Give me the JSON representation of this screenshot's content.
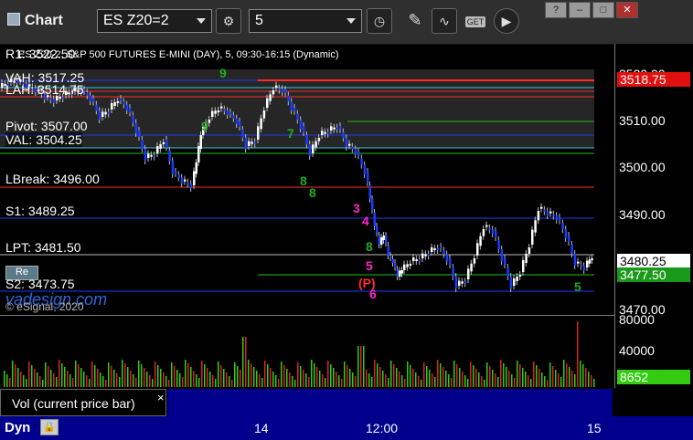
{
  "window": {
    "title": "Chart",
    "controls": [
      "?",
      "–",
      "□",
      "✕"
    ]
  },
  "toolbar": {
    "symbol": "ES Z20=2",
    "interval": "5",
    "icons": [
      "gear-icon",
      "clock-icon",
      "pencil-icon",
      "indicator-icon",
      "get-data-icon",
      "play-icon"
    ],
    "get_label": "GET"
  },
  "chart": {
    "header": "ES Z20-2, S&P 500 FUTURES E-MINI (DAY), 5, 09:30-16:15 (Dynamic)",
    "levels": {
      "r1": "R1: 3522.50",
      "vah": "VAH: 3517.25",
      "lah": "LAH: 3514.75",
      "pivot": "Pivot: 3507.00",
      "val": "VAL: 3504.25",
      "lbreak": "LBreak: 3496.00",
      "s1": "S1: 3489.25",
      "lpt": "LPT: 3481.50",
      "s2": "S2: 3473.75"
    },
    "price_ticks": [
      "3520.00",
      "3510.00",
      "3500.00",
      "3490.00",
      "3480.25",
      "3477.50",
      "3470.00"
    ],
    "last_price": "3518.75",
    "current_price": "3480.25",
    "other_price": "3477.50",
    "markers": [
      "9",
      "8",
      "3",
      "4",
      "5",
      "(P)",
      "6",
      "5",
      "8",
      "8",
      "7",
      "9"
    ],
    "watermark": "vadesign.com",
    "copyright": "© eSignal, 2020",
    "badge": "Re",
    "colors": {
      "up": "#ffffff",
      "down": "#1a3cff",
      "red_line": "#ff2a2a",
      "green_line": "#22bb22",
      "blue_line": "#1a3cff",
      "magenta": "#ff22cc"
    }
  },
  "volume": {
    "ticks": [
      "80000",
      "40000"
    ],
    "current": "8652",
    "study_label": "Vol (current price bar)",
    "close": "×"
  },
  "time_axis": {
    "labels": [
      "14",
      "12:00",
      "15"
    ],
    "mode": "Dyn",
    "lock_icon": "lock-icon"
  }
}
